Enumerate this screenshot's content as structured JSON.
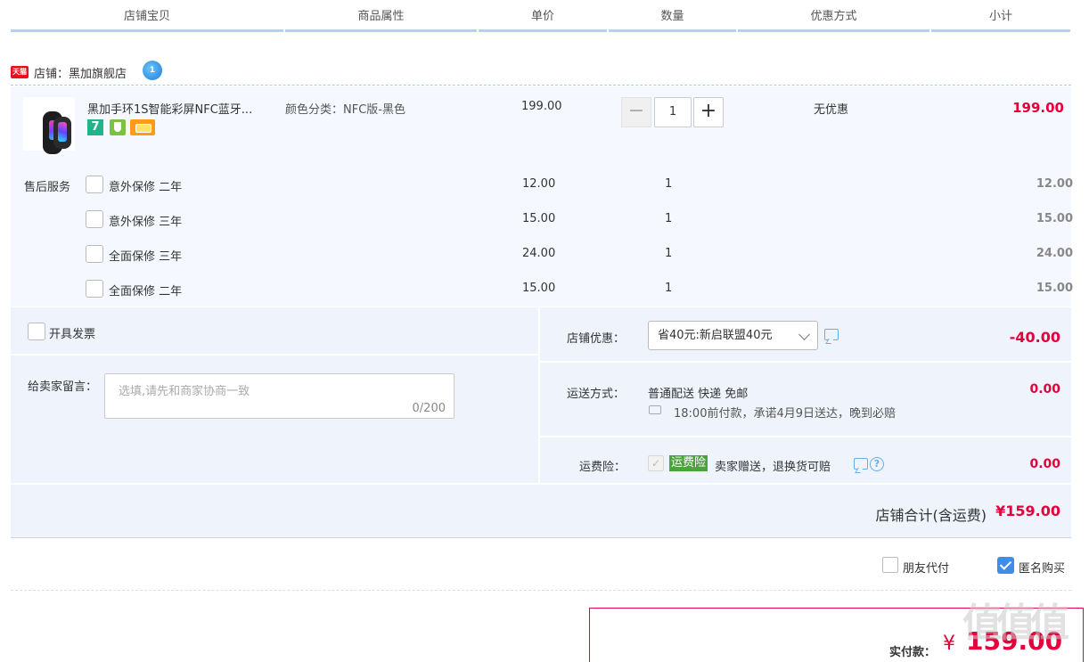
{
  "columns": [
    "店铺宝贝",
    "商品属性",
    "单价",
    "数量",
    "优惠方式",
    "小计"
  ],
  "shop": {
    "tmall_badge": "天猫",
    "name": "店铺：黑加旗舰店",
    "ww_badge": "1"
  },
  "item": {
    "title": "黑加手环1S智能彩屏NFC蓝牙...",
    "badge_7": "7",
    "attr": "颜色分类：NFC版-黑色",
    "price": "199.00",
    "qty": "1",
    "minus": "−",
    "plus": "+",
    "discount": "无优惠",
    "subtotal": "199.00"
  },
  "service": {
    "label": "售后服务",
    "items": [
      {
        "name": "意外保修 二年",
        "price": "12.00",
        "qty": "1",
        "subtotal": "12.00"
      },
      {
        "name": "意外保修 三年",
        "price": "15.00",
        "qty": "1",
        "subtotal": "15.00"
      },
      {
        "name": "全面保修 三年",
        "price": "24.00",
        "qty": "1",
        "subtotal": "24.00"
      },
      {
        "name": "全面保修 二年",
        "price": "15.00",
        "qty": "1",
        "subtotal": "15.00"
      }
    ]
  },
  "order": {
    "invoice_label": "开具发票",
    "message_label": "给卖家留言：",
    "message_placeholder": "选填,请先和商家协商一致",
    "message_count": "0/200",
    "coupon_label": "店铺优惠：",
    "coupon_selected": "省40元:新启联盟40元",
    "coupon_value": "-40.00",
    "shipping_label": "运送方式：",
    "shipping_method": "普通配送 快递 免邮",
    "shipping_note": "18:00前付款，承诺4月9日送达，晚到必赔",
    "shipping_price": "0.00",
    "insurance_label": "运费险：",
    "insurance_check": "✓",
    "insurance_tag": "运费险",
    "insurance_text": "卖家赠送，退换货可赔",
    "insurance_help": "?",
    "insurance_price": "0.00",
    "total_label": "店铺合计(含运费)",
    "total_value": "¥159.00"
  },
  "options": {
    "friend_pay": "朋友代付",
    "anonymous": "匿名购买",
    "anonymous_checked": true
  },
  "payment": {
    "label": "实付款：",
    "currency": "¥",
    "amount": "159.00"
  },
  "watermark": "值值值",
  "colors": {
    "accent_red": "#e4003a",
    "header_line": "#b2d1f6",
    "panel_bg": "#eef3fc",
    "check_blue": "#3e8ee8"
  }
}
